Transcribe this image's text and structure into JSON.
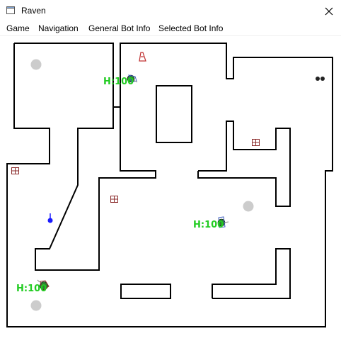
{
  "window": {
    "title": "Raven",
    "icon": "window-icon",
    "close_icon": "close-icon"
  },
  "menu": {
    "items": [
      {
        "label": "Game"
      },
      {
        "label": "Navigation"
      },
      {
        "label": "General Bot Info"
      },
      {
        "label": "Selected Bot Info"
      }
    ]
  },
  "arena": {
    "colors": {
      "walls": "#000000",
      "hp_text": "#22cc22",
      "spawn_point": "#cccccc",
      "bot_body": "#2e7d32",
      "waypoint": "#1a1aff",
      "item_outline": "#8b2b2b"
    },
    "bots": [
      {
        "health_label": "H:100"
      },
      {
        "health_label": "H:100"
      },
      {
        "health_label": "H:100"
      }
    ],
    "items": [
      "health-pack",
      "health-pack",
      "health-pack",
      "weapon-rocket-launcher",
      "weapon-shotgun"
    ],
    "spawn_point_count": 3
  }
}
